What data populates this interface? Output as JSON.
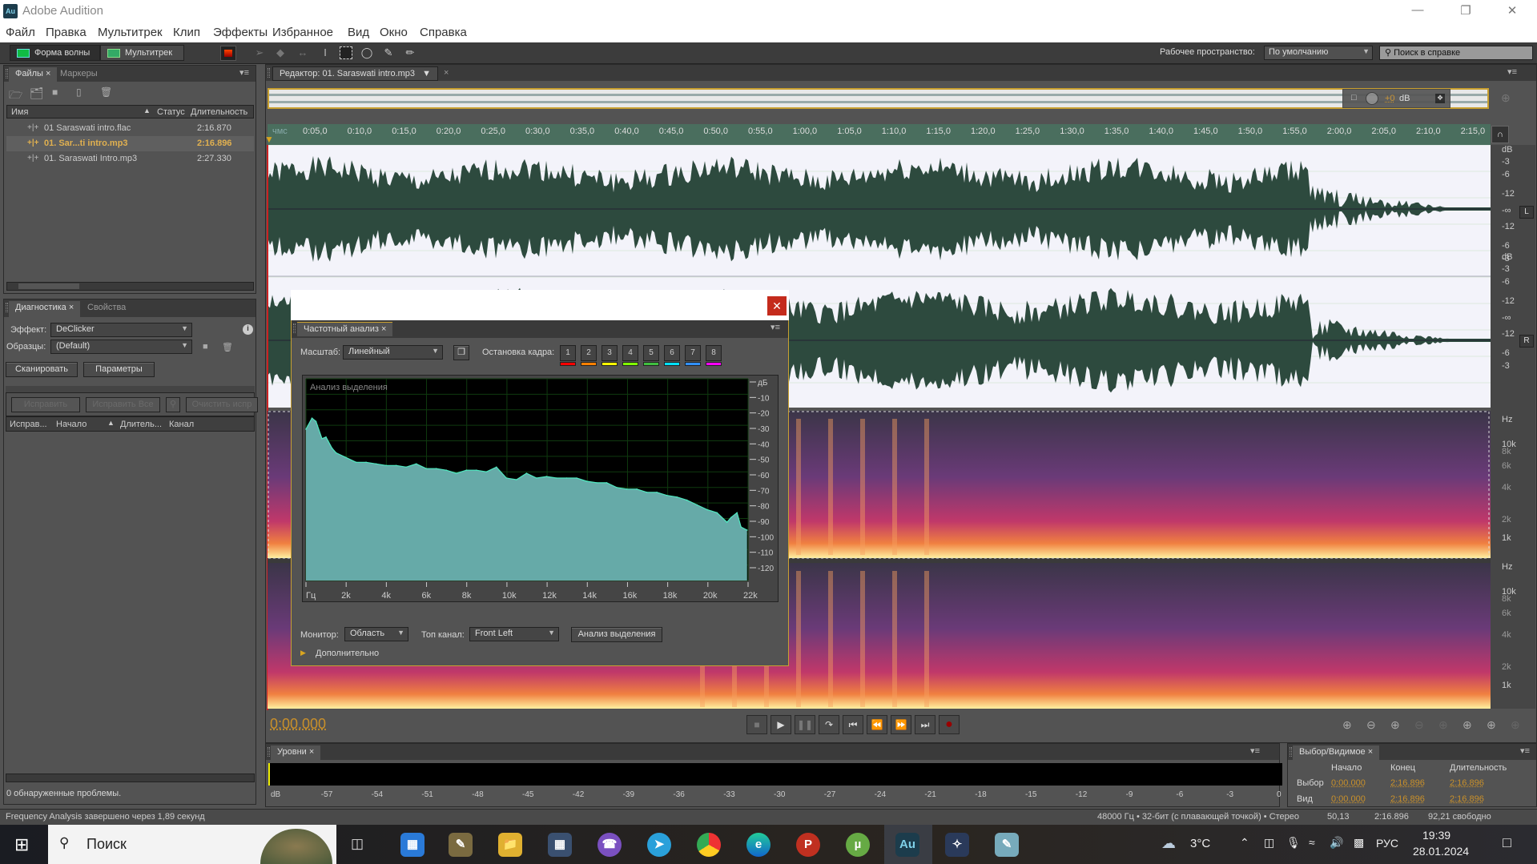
{
  "window": {
    "title": "Adobe Audition",
    "logo": "Au",
    "controls": [
      "minimize-icon",
      "maximize-icon",
      "close-icon"
    ]
  },
  "menu": [
    "Файл",
    "Правка",
    "Мультитрек",
    "Клип",
    "Эффекты",
    "Избранное",
    "Вид",
    "Окно",
    "Справка"
  ],
  "toolbar": {
    "waveform_label": "Форма волны",
    "multitrack_label": "Мультитрек",
    "workspace_label": "Рабочее пространство:",
    "workspace_value": "По умолчанию",
    "help_placeholder": "Поиск в справке"
  },
  "files_panel": {
    "tabs": [
      "Файлы",
      "Маркеры"
    ],
    "columns": [
      "Имя",
      "Статус",
      "Длительность"
    ],
    "rows": [
      {
        "name": "01 Saraswati intro.flac",
        "duration": "2:16.870",
        "selected": false
      },
      {
        "name": "01. Sar...ti intro.mp3",
        "duration": "2:16.896",
        "selected": true
      },
      {
        "name": "01. Saraswati Intro.mp3",
        "duration": "2:27.330",
        "selected": false
      }
    ]
  },
  "diag_panel": {
    "tabs": [
      "Диагностика",
      "Свойства"
    ],
    "effect_label": "Эффект:",
    "effect_value": "DeClicker",
    "presets_label": "Образцы:",
    "presets_value": "(Default)",
    "scan_label": "Сканировать",
    "params_label": "Параметры",
    "fix_label": "Исправить",
    "fix_all_label": "Исправить Все",
    "clear_label": "Очистить испр",
    "columns": [
      "Исправ...",
      "Начало",
      "Длитель...",
      "Канал"
    ],
    "status": "0 обнаруженные проблемы."
  },
  "editor": {
    "tab_label": "Редактор: 01. Saraswati intro.mp3",
    "gain": "+0",
    "gain_unit": "dB",
    "ruler_unit": "чмс",
    "ruler_ticks": [
      "0:05,0",
      "0:10,0",
      "0:15,0",
      "0:20,0",
      "0:25,0",
      "0:30,0",
      "0:35,0",
      "0:40,0",
      "0:45,0",
      "0:50,0",
      "0:55,0",
      "1:00,0",
      "1:05,0",
      "1:10,0",
      "1:15,0",
      "1:20,0",
      "1:25,0",
      "1:30,0",
      "1:35,0",
      "1:40,0",
      "1:45,0",
      "1:50,0",
      "1:55,0",
      "2:00,0",
      "2:05,0",
      "2:10,0",
      "2:15,0"
    ],
    "db_scale": [
      "dB",
      "-3",
      "-6",
      "-12",
      "-∞",
      "-12",
      "-6",
      "-3"
    ],
    "channels": [
      "L",
      "R"
    ],
    "hz_scale": [
      "Hz",
      "10k",
      "8k",
      "6k",
      "4k",
      "2k",
      "1k"
    ],
    "time": "0:00.000"
  },
  "freq_dialog": {
    "tab_label": "Частотный анализ",
    "scale_label": "Масштаб:",
    "scale_value": "Линейный",
    "freeze_label": "Остановка кадра:",
    "freeze_buttons": [
      {
        "label": "1",
        "color": "#ff0000"
      },
      {
        "label": "2",
        "color": "#ff8000"
      },
      {
        "label": "3",
        "color": "#ffff00"
      },
      {
        "label": "4",
        "color": "#80ff00"
      },
      {
        "label": "5",
        "color": "#40c040"
      },
      {
        "label": "6",
        "color": "#00e0ff"
      },
      {
        "label": "7",
        "color": "#3090ff"
      },
      {
        "label": "8",
        "color": "#ff00ff"
      }
    ],
    "monitor_label": "Монитор:",
    "monitor_value": "Область",
    "top_channel_label": "Топ канал:",
    "top_channel_value": "Front Left",
    "analyze_label": "Анализ выделения",
    "advanced_label": "Дополнительно"
  },
  "chart_data": {
    "type": "area",
    "title": "Анализ выделения",
    "xlabel": "Гц",
    "ylabel": "дБ",
    "x_ticks": [
      "Гц",
      "2k",
      "4k",
      "6k",
      "8k",
      "10k",
      "12k",
      "14k",
      "16k",
      "18k",
      "20k",
      "22k"
    ],
    "y_ticks": [
      "дБ",
      "-10",
      "-20",
      "-30",
      "-40",
      "-50",
      "-60",
      "-70",
      "-80",
      "-90",
      "-100",
      "-110",
      "-120"
    ],
    "xlim": [
      0,
      22050
    ],
    "ylim": [
      -128,
      0
    ],
    "grid": true,
    "x": [
      0,
      300,
      500,
      800,
      1000,
      1300,
      1500,
      2000,
      2500,
      3000,
      3500,
      4000,
      4500,
      5000,
      5500,
      6000,
      6500,
      7000,
      7500,
      8000,
      8500,
      9000,
      9500,
      10000,
      10500,
      11000,
      11500,
      12000,
      12500,
      13000,
      13500,
      14000,
      14500,
      15000,
      15500,
      16000,
      16500,
      17000,
      17500,
      18000,
      18500,
      19000,
      19500,
      20000,
      20500,
      21000,
      21200,
      21500,
      21700,
      22000
    ],
    "values": [
      -32,
      -25,
      -27,
      -38,
      -37,
      -44,
      -47,
      -50,
      -53,
      -53,
      -54,
      -55,
      -55,
      -56,
      -54,
      -57,
      -57,
      -58,
      -60,
      -58,
      -58,
      -59,
      -56,
      -63,
      -64,
      -60,
      -63,
      -62,
      -63,
      -63,
      -63,
      -65,
      -66,
      -66,
      -69,
      -70,
      -70,
      -72,
      -72,
      -74,
      -75,
      -77,
      -80,
      -83,
      -85,
      -91,
      -88,
      -85,
      -94,
      -96
    ]
  },
  "transport": [
    "stop-icon",
    "play-icon",
    "pause-icon",
    "loop-icon",
    "prev-icon",
    "rewind-icon",
    "forward-icon",
    "next-icon",
    "record-icon"
  ],
  "levels": {
    "tab_label": "Уровни",
    "scale": [
      "dB",
      "-57",
      "-54",
      "-51",
      "-48",
      "-45",
      "-42",
      "-39",
      "-36",
      "-33",
      "-30",
      "-27",
      "-24",
      "-21",
      "-18",
      "-15",
      "-12",
      "-9",
      "-6",
      "-3",
      "0"
    ]
  },
  "selection_view": {
    "tab_label": "Выбор/Видимое",
    "columns": [
      "Начало",
      "Конец",
      "Длительность"
    ],
    "rows": [
      {
        "label": "Выбор",
        "start": "0:00.000",
        "end": "2:16.896",
        "duration": "2:16.896"
      },
      {
        "label": "Вид",
        "start": "0:00.000",
        "end": "2:16.896",
        "duration": "2:16.896"
      }
    ]
  },
  "statusbar": {
    "message": "Frequency Analysis завершено через 1,89 секунд",
    "format": "48000 Гц • 32-бит (с плавающей точкой) • Стерео",
    "size": "50,13",
    "duration": "2:16.896",
    "free": "92,21  свободно"
  },
  "taskbar": {
    "search_label": "Поиск",
    "weather": "3°C",
    "lang": "РУС",
    "time": "19:39",
    "date": "28.01.2024"
  }
}
